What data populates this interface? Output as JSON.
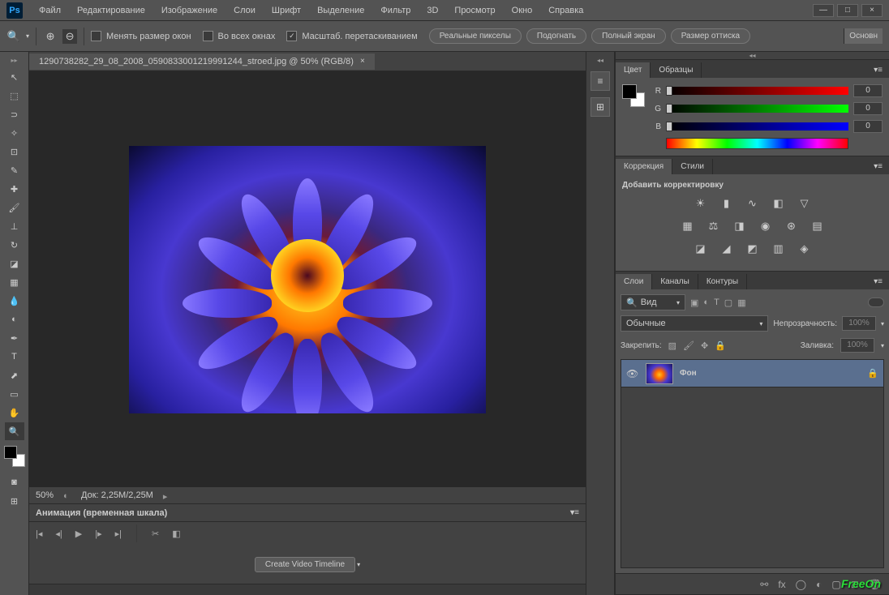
{
  "app": {
    "logo": "Ps"
  },
  "menu": [
    "Файл",
    "Редактирование",
    "Изображение",
    "Слои",
    "Шрифт",
    "Выделение",
    "Фильтр",
    "3D",
    "Просмотр",
    "Окно",
    "Справка"
  ],
  "win_btns": {
    "min": "—",
    "max": "□",
    "close": "×"
  },
  "options": {
    "resize_windows": "Менять размер окон",
    "all_windows": "Во всех окнах",
    "drag_zoom": "Масштаб. перетаскиванием",
    "actual": "Реальные пикселы",
    "fit": "Подогнать",
    "full": "Полный экран",
    "print_size": "Размер оттиска",
    "main": "Основн"
  },
  "document": {
    "tab": "1290738282_29_08_2008_0590833001219991244_stroed.jpg @ 50% (RGB/8)",
    "close": "×",
    "zoom": "50%",
    "doc_size": "Док: 2,25M/2,25M"
  },
  "animation": {
    "title": "Анимация (временная шкала)",
    "create_btn": "Create Video Timeline"
  },
  "color_panel": {
    "tabs": [
      "Цвет",
      "Образцы"
    ],
    "channels": {
      "r": "R",
      "g": "G",
      "b": "B"
    },
    "values": {
      "r": "0",
      "g": "0",
      "b": "0"
    }
  },
  "adjust_panel": {
    "tabs": [
      "Коррекция",
      "Стили"
    ],
    "title": "Добавить корректировку"
  },
  "layers_panel": {
    "tabs": [
      "Слои",
      "Каналы",
      "Контуры"
    ],
    "filter": "Вид",
    "blend": "Обычные",
    "opacity_lbl": "Непрозрачность:",
    "opacity_val": "100%",
    "lock_lbl": "Закрепить:",
    "fill_lbl": "Заливка:",
    "fill_val": "100%",
    "layer_name": "Фон"
  },
  "watermark": "FreeOn"
}
